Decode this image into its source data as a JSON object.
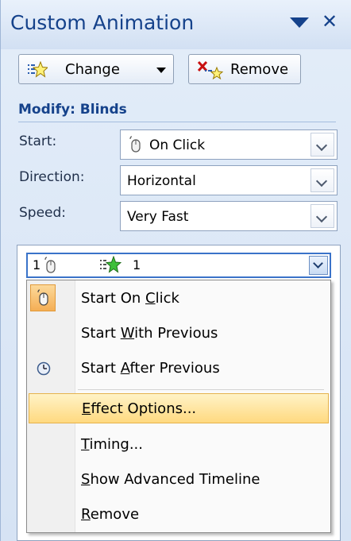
{
  "pane": {
    "title": "Custom Animation",
    "change_label": "Change",
    "remove_label": "Remove",
    "modify_heading": "Modify: Blinds"
  },
  "fields": {
    "start_label": "Start:",
    "start_value": "On Click",
    "direction_label": "Direction:",
    "direction_value": "Horizontal",
    "speed_label": "Speed:",
    "speed_value": "Very Fast"
  },
  "animation_list": {
    "item_order": "1",
    "item_name": "1"
  },
  "context_menu": {
    "start_on_click_pre": "Start On ",
    "start_on_click_key": "C",
    "start_on_click_post": "lick",
    "start_with_previous_pre": "Start ",
    "start_with_previous_key": "W",
    "start_with_previous_post": "ith Previous",
    "start_after_previous_pre": "Start ",
    "start_after_previous_key": "A",
    "start_after_previous_post": "fter Previous",
    "effect_options_key": "E",
    "effect_options_post": "ffect Options...",
    "timing_key": "T",
    "timing_post": "iming...",
    "show_advanced_key": "S",
    "show_advanced_post": "how Advanced Timeline",
    "remove_key": "R",
    "remove_post": "emove"
  },
  "colors": {
    "title": "#15428b",
    "highlight": "#ffd980",
    "pane_bg": "#dde8f6"
  }
}
